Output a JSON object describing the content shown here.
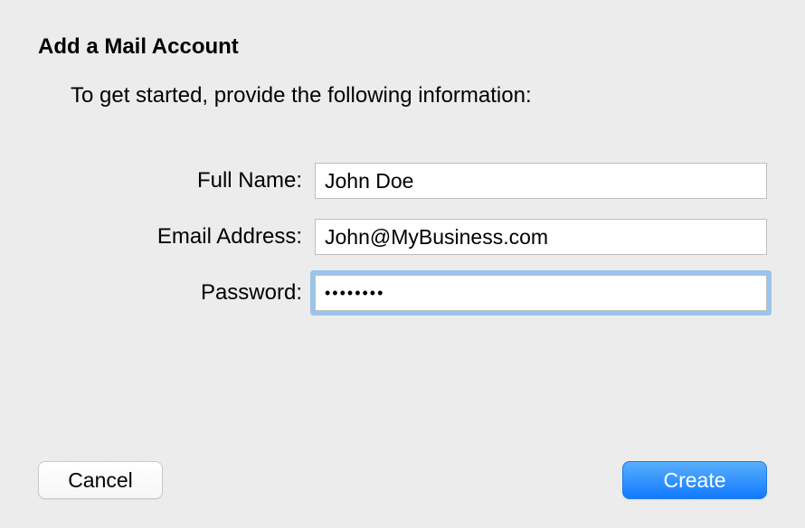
{
  "title": "Add a Mail Account",
  "subtitle": "To get started, provide the following information:",
  "form": {
    "fullName": {
      "label": "Full Name:",
      "value": "John Doe"
    },
    "email": {
      "label": "Email Address:",
      "value": "John@MyBusiness.com"
    },
    "password": {
      "label": "Password:",
      "value": "••••••••"
    }
  },
  "buttons": {
    "cancel": "Cancel",
    "create": "Create"
  }
}
